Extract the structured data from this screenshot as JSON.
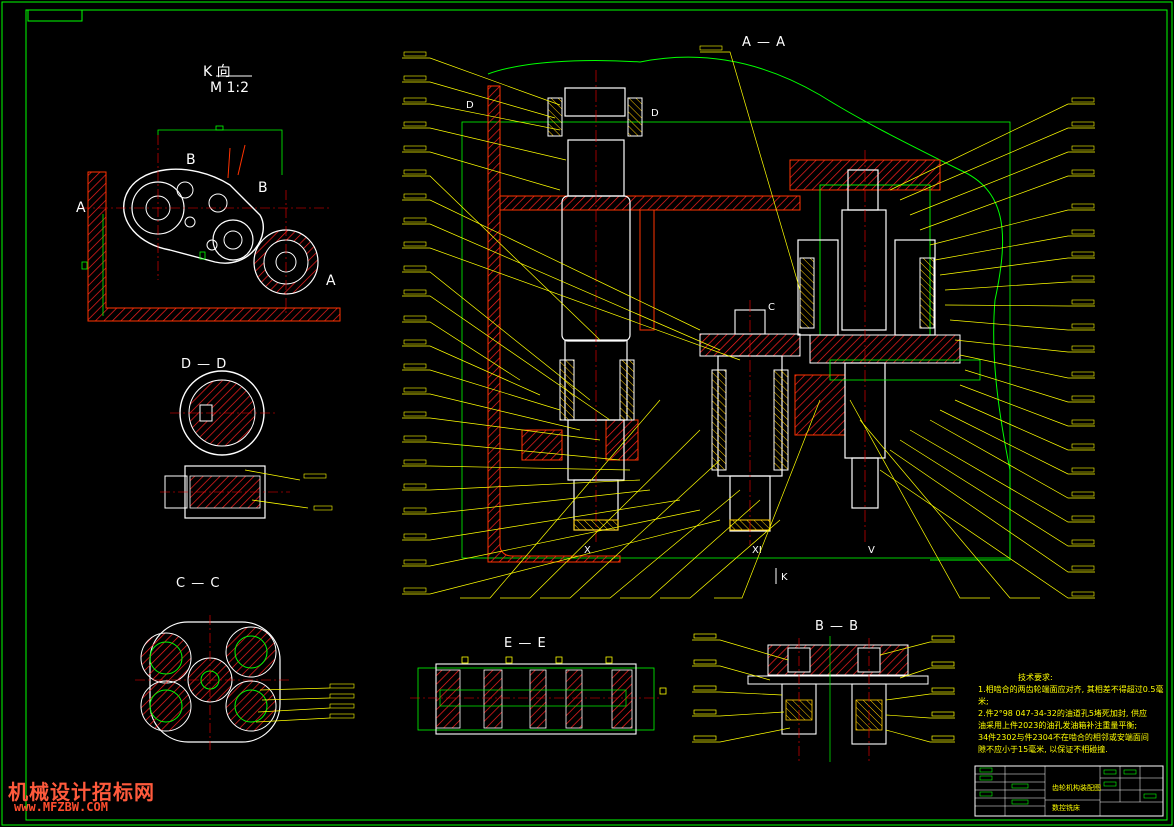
{
  "drawing": {
    "views": {
      "k_view": {
        "title": "K 向",
        "scale": "M 1:2",
        "marks": [
          "A",
          "A",
          "B",
          "B"
        ]
      },
      "d_view": {
        "title": "D — D"
      },
      "c_view": {
        "title": "C — C"
      },
      "e_view": {
        "title": "E — E"
      },
      "a_view": {
        "title": "A — A",
        "marks": [
          "D",
          "D",
          "C",
          "X",
          "XI",
          "V",
          "K"
        ]
      },
      "b_view": {
        "title": "B — B"
      }
    },
    "notes": {
      "heading": "技术要求:",
      "lines": [
        "1.相啮合的两齿轮端面应对齐, 其相差不得超过0.5毫",
        "米;",
        "2.件2°98 047-34-32的油道孔5堵死加封, 供应",
        "油采用上件2023的油孔发油箱补注重量平衡;",
        "34件2302与件2304不在啮合的相邻或安端面间",
        "隙不应小于15毫米, 以保证不相碰撞."
      ]
    },
    "title_block": {
      "name": "齿轮机构装配图",
      "subtitle": "数控铣床",
      "sheet": ""
    },
    "watermark": {
      "cn": "机械设计招标网",
      "url": "www.MFZBW.COM"
    },
    "colors": {
      "background": "#000000",
      "frame": "#00ff00",
      "outline": "#ffffff",
      "leader": "#ffff00",
      "section": "#ff3300",
      "hatch": "#ff0000",
      "centerline": "#ff0000",
      "notes": "#ffff00",
      "watermark": "#ff5a3c"
    }
  }
}
